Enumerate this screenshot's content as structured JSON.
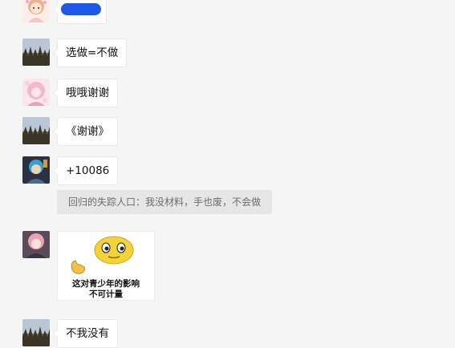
{
  "colors": {
    "page_bg": "#f5f5f5",
    "bubble_bg": "#ffffff",
    "quote_bg": "#e6e6e6",
    "redaction_blue": "#1f57e6"
  },
  "messages": [
    {
      "type": "redacted",
      "avatar": "anime-girl-avatar"
    },
    {
      "type": "text",
      "avatar": "landscape-trees-avatar",
      "text": "选做=不做"
    },
    {
      "type": "text",
      "avatar": "pink-anime-avatar",
      "text": "哦哦谢谢"
    },
    {
      "type": "text",
      "avatar": "landscape-trees-avatar",
      "text": "《谢谢》"
    },
    {
      "type": "text",
      "avatar": "blue-haired-anime-avatar",
      "text": "+10086"
    },
    {
      "type": "quote",
      "text": "回归的失踪人口：我没材料，手也废，不会做"
    },
    {
      "type": "image",
      "avatar": "pink-haired-anime-avatar",
      "sticker_line1": "这对青少年的影响",
      "sticker_line2": "不可计量"
    },
    {
      "type": "text",
      "avatar": "landscape-trees-avatar",
      "text": "不我没有"
    }
  ]
}
